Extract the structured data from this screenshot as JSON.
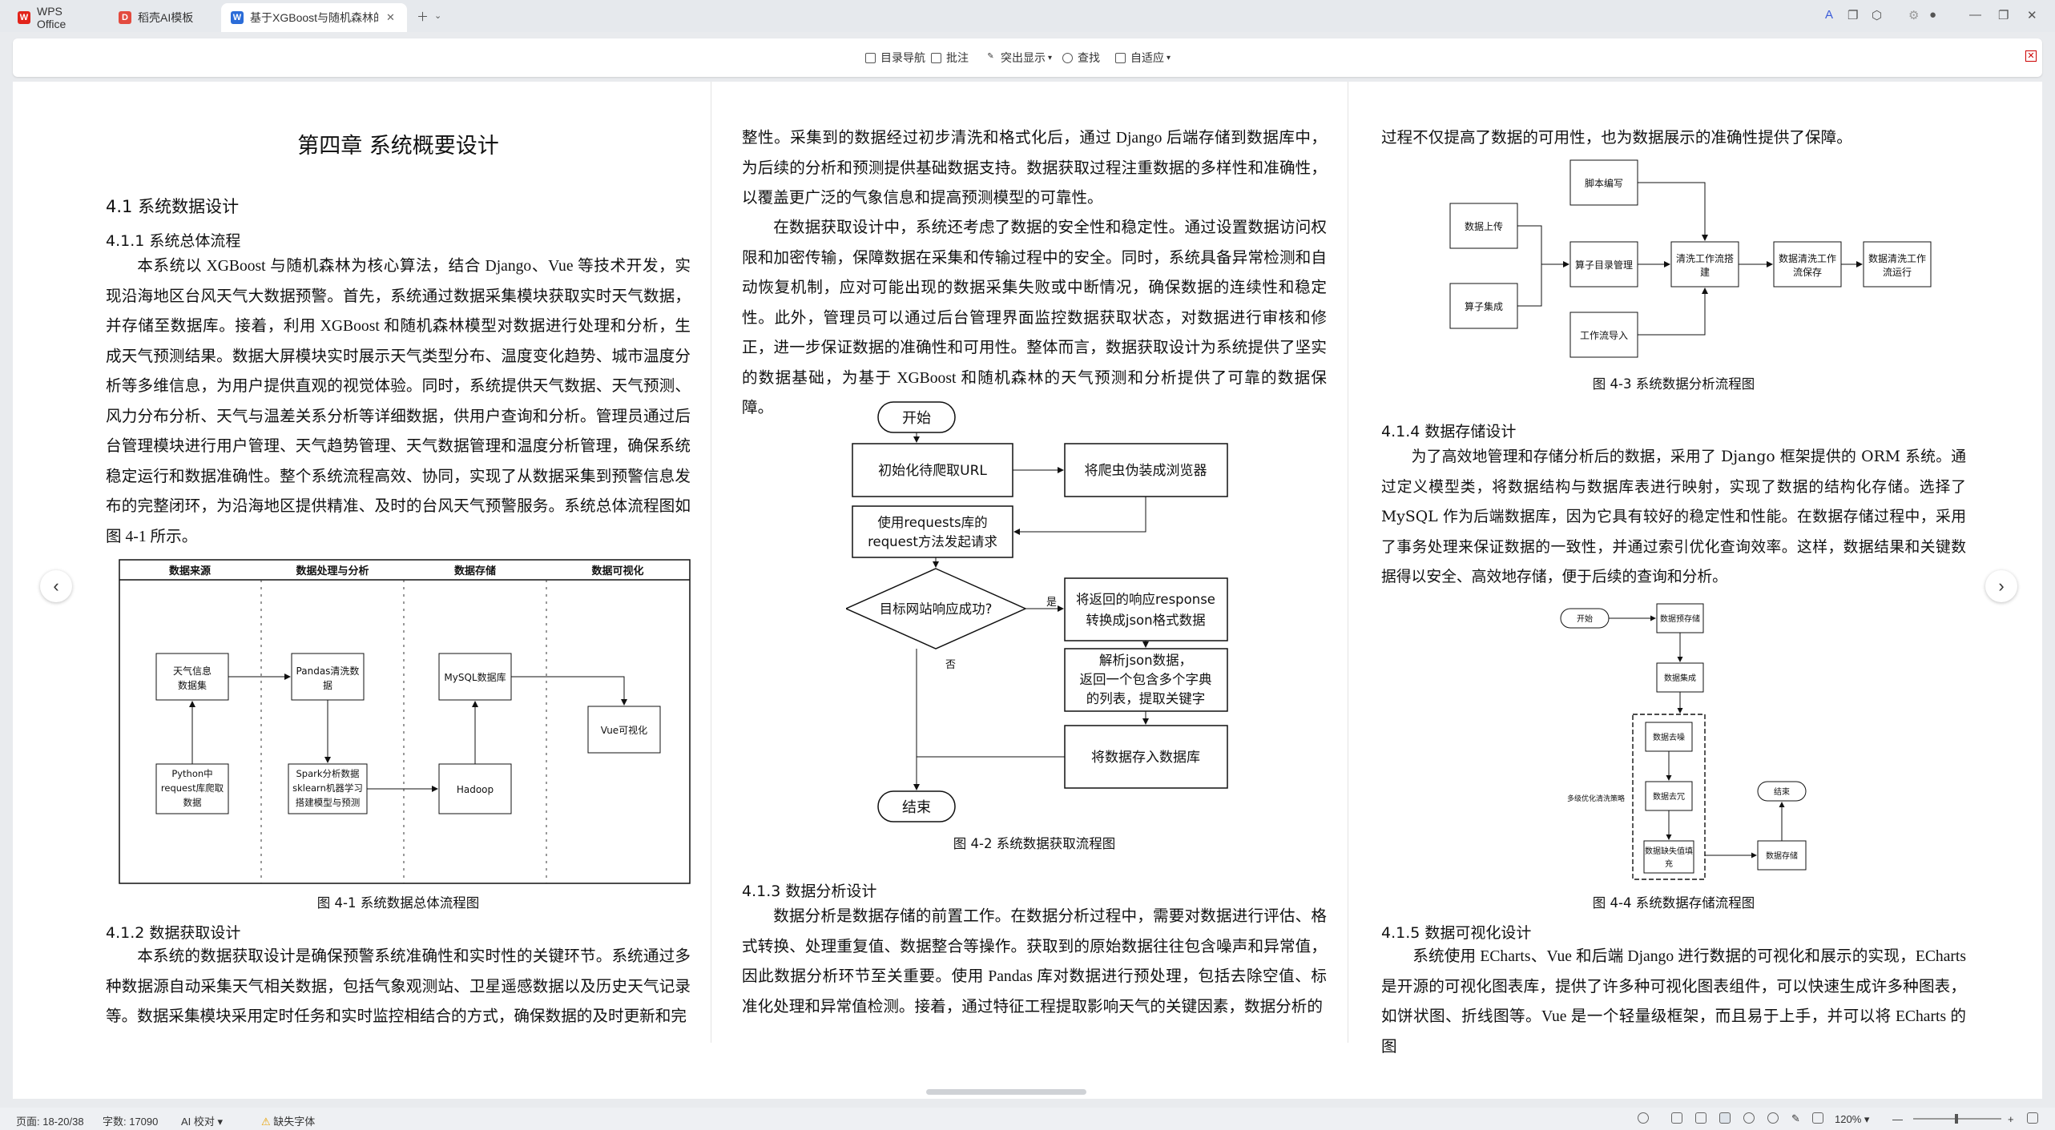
{
  "tabs": [
    {
      "label": "WPS Office",
      "icon": "wps-logo",
      "color": "#e2231a"
    },
    {
      "label": "稻壳AI模板",
      "icon": "docer-logo",
      "color": "#e34b3f"
    },
    {
      "label": "基于XGBoost与随机森林的...",
      "icon": "writer-logo",
      "color": "#2b6cd8"
    }
  ],
  "toolbar": {
    "toc": "目录导航",
    "comment": "批注",
    "highlight": "突出显示",
    "find": "查找",
    "fit": "自适应"
  },
  "col1": {
    "chapter": "第四章  系统概要设计",
    "s41": "4.1 系统数据设计",
    "s411": "4.1.1    系统总体流程",
    "p1": "本系统以 XGBoost 与随机森林为核心算法，结合 Django、Vue 等技术开发，实现沿海地区台风天气大数据预警。首先，系统通过数据采集模块获取实时天气数据，并存储至数据库。接着，利用 XGBoost 和随机森林模型对数据进行处理和分析，生成天气预测结果。数据大屏模块实时展示天气类型分布、温度变化趋势、城市温度分析等多维信息，为用户提供直观的视觉体验。同时，系统提供天气数据、天气预测、风力分布分析、天气与温差关系分析等详细数据，供用户查询和分析。管理员通过后台管理模块进行用户管理、天气趋势管理、天气数据管理和温度分析管理，确保系统稳定运行和数据准确性。整个系统流程高效、协同，实现了从数据采集到预警信息发布的完整闭环，为沿海地区提供精准、及时的台风天气预警服务。系统总体流程图如图 4-1 所示。",
    "fig1": {
      "headers": [
        "数据来源",
        "数据处理与分析",
        "数据存储",
        "数据可视化"
      ],
      "b1": "天气信息数据集",
      "b2": "Pandas清洗数据",
      "b3": "MySQL数据库",
      "b4": "Vue可视化",
      "b5a": "Python中",
      "b5b": "request库爬取",
      "b5c": "数据",
      "b6a": "Spark分析数据",
      "b6b": "sklearn机器学习",
      "b6c": "搭建模型与预测",
      "b7": "Hadoop"
    },
    "cap1": "图 4-1  系统数据总体流程图",
    "s412": "4.1.2    数据获取设计",
    "p2": "本系统的数据获取设计是确保预警系统准确性和实时性的关键环节。系统通过多种数据源自动采集天气相关数据，包括气象观测站、卫星遥感数据以及历史天气记录等。数据采集模块采用定时任务和实时监控相结合的方式，确保数据的及时更新和完"
  },
  "col2": {
    "p1": "整性。采集到的数据经过初步清洗和格式化后，通过 Django 后端存储到数据库中，为后续的分析和预测提供基础数据支持。数据获取过程注重数据的多样性和准确性，以覆盖更广泛的气象信息和提高预测模型的可靠性。",
    "p2": "在数据获取设计中，系统还考虑了数据的安全性和稳定性。通过设置数据访问权限和加密传输，保障数据在采集和传输过程中的安全。同时，系统具备异常检测和自动恢复机制，应对可能出现的数据采集失败或中断情况，确保数据的连续性和稳定性。此外，管理员可以通过后台管理界面监控数据获取状态，对数据进行审核和修正，进一步保证数据的准确性和可用性。整体而言，数据获取设计为系统提供了坚实的数据基础，为基于 XGBoost 和随机森林的天气预测和分析提供了可靠的数据保障。",
    "fig2": {
      "start": "开始",
      "n1": "初始化待爬取URL",
      "n2": "将爬虫伪装成浏览器",
      "n3a": "使用requests库的",
      "n3b": "request方法发起请求",
      "d1": "目标网站响应成功?",
      "yes": "是",
      "no": "否",
      "n4a": "将返回的响应response",
      "n4b": "转换成json格式数据",
      "n5a": "解析json数据，",
      "n5b": "返回一个包含多个字典",
      "n5c": "的列表，提取关键字",
      "n6": "将数据存入数据库",
      "end": "结束"
    },
    "cap2": "图 4-2  系统数据获取流程图",
    "s413": "4.1.3    数据分析设计",
    "p3": "数据分析是数据存储的前置工作。在数据分析过程中，需要对数据进行评估、格式转换、处理重复值、数据整合等操作。获取到的原始数据往往包含噪声和异常值，因此数据分析环节至关重要。使用 Pandas 库对数据进行预处理，包括去除空值、标准化处理和异常值检测。接着，通过特征工程提取影响天气的关键因素，数据分析的"
  },
  "col3": {
    "p1": "过程不仅提高了数据的可用性，也为数据展示的准确性提供了保障。",
    "fig3": {
      "a": "脚本编写",
      "b": "数据上传",
      "c": "算子目录管理",
      "d": "清洗工作流搭",
      "d2": "建",
      "e": "数据清洗工作",
      "e2": "流保存",
      "f": "数据清洗工作",
      "f2": "流运行",
      "g": "算子集成",
      "h": "工作流导入"
    },
    "cap3": "图 4-3  系统数据分析流程图",
    "s414": "4.1.4    数据存储设计",
    "p2": "为了高效地管理和存储分析后的数据，采用了 Django 框架提供的 ORM 系统。通过定义模型类，将数据结构与数据库表进行映射，实现了数据的结构化存储。选择了 MySQL 作为后端数据库，因为它具有较好的稳定性和性能。在数据存储过程中，采用了事务处理来保证数据的一致性，并通过索引优化查询效率。这样，数据结果和关键数据得以安全、高效地存储，便于后续的查询和分析。",
    "fig4": {
      "start": "开始",
      "n1": "数据预存储",
      "n2": "数据集成",
      "n3": "数据去噪",
      "n4": "数据去冗",
      "n5a": "数据缺失值填",
      "n5b": "充",
      "n6": "数据存储",
      "end": "结束",
      "side": "多级优化清洗策略"
    },
    "cap4": "图 4-4  系统数据存储流程图",
    "s415": "4.1.5    数据可视化设计",
    "p3": "系统使用 ECharts、Vue 和后端 Django 进行数据的可视化和展示的实现，ECharts 是开源的可视化图表库，提供了许多种可视化图表组件，可以快速生成许多种图表，如饼状图、折线图等。Vue 是一个轻量级框架，而且易于上手，并可以将 ECharts 的图"
  },
  "status": {
    "page": "页面: 18-20/38",
    "words": "字数: 17090",
    "ai": "AI 校对",
    "font": "缺失字体",
    "zoom": "120%"
  }
}
